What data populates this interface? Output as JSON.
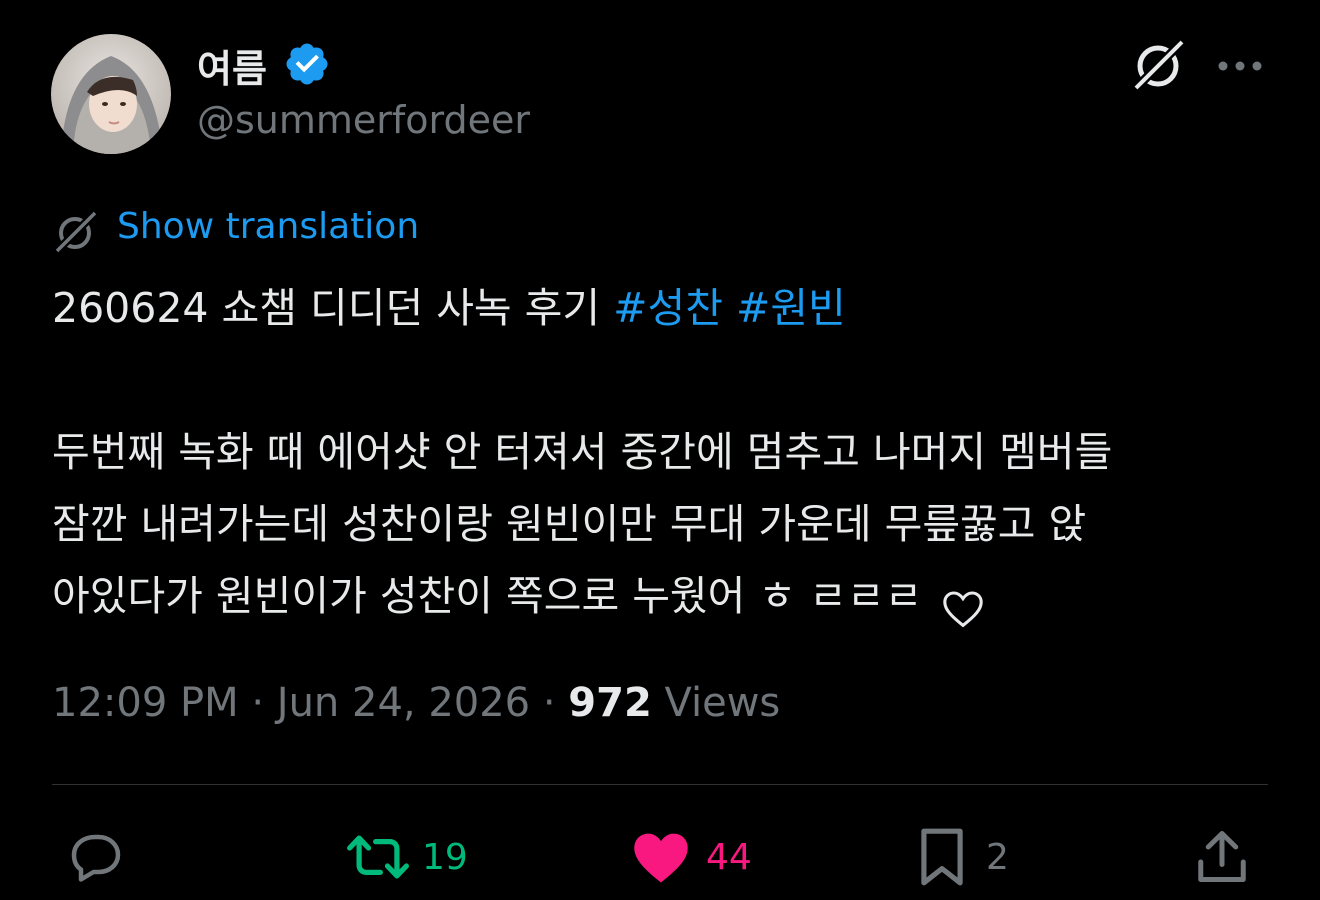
{
  "author": {
    "display_name": "여름",
    "handle": "@summerfordeer",
    "verified": true,
    "avatar_icon": "user-avatar"
  },
  "header_icons": {
    "grok": "grok-icon",
    "more": "more-icon"
  },
  "translation": {
    "label": "Show translation",
    "icon": "grok-translate-icon"
  },
  "tweet": {
    "line1_text": "260624 쇼챔 디디던 사녹 후기 ",
    "hashtags": [
      "#성찬",
      "#원빈"
    ],
    "line2": "두번째 녹화 때 에어샷 안 터져서 중간에 멈추고 나머지 멤버들",
    "line3": "잠깐 내려가는데 성찬이랑 원빈이만 무대 가운데 무릎꿇고 앉",
    "line4": "아있다가 원빈이가 성찬이 쪽으로 누웠어 ㅎ ㄹㄹㄹ ",
    "line4_icon": "heart-outline-icon"
  },
  "meta": {
    "time": "12:09 PM",
    "sep1": " · ",
    "date": "Jun 24, 2026",
    "sep2": " · ",
    "views_count": "972",
    "views_label": " Views"
  },
  "actions": {
    "reply": {
      "icon": "reply-icon",
      "count": ""
    },
    "retweet": {
      "icon": "retweet-icon",
      "count": "19",
      "color": "#00ba7c"
    },
    "like": {
      "icon": "heart-icon",
      "count": "44",
      "color": "#f91880"
    },
    "bookmark": {
      "icon": "bookmark-icon",
      "count": "2"
    },
    "share": {
      "icon": "share-icon"
    }
  },
  "colors": {
    "accent": "#1d9bf0",
    "secondary_text": "#71767b",
    "background": "#000000"
  }
}
